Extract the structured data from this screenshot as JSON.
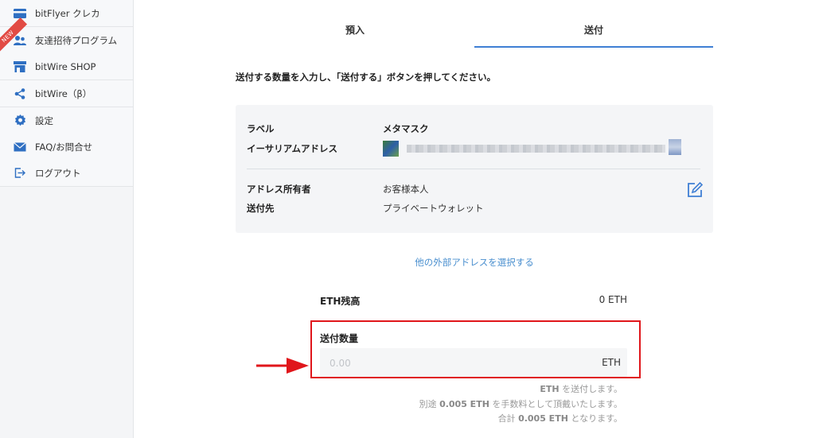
{
  "sidebar": {
    "items": [
      {
        "label": "bitFlyer クレカ",
        "icon": "credit-card-icon"
      },
      {
        "label": "友達招待プログラム",
        "icon": "users-icon",
        "badge": "NEW"
      },
      {
        "label": "bitWire SHOP",
        "icon": "store-icon"
      },
      {
        "label": "bitWire（β）",
        "icon": "share-icon"
      },
      {
        "label": "設定",
        "icon": "gear-icon"
      },
      {
        "label": "FAQ/お問合せ",
        "icon": "mail-icon"
      },
      {
        "label": "ログアウト",
        "icon": "logout-icon"
      }
    ]
  },
  "tabs": [
    {
      "label": "預入",
      "active": false
    },
    {
      "label": "送付",
      "active": true
    }
  ],
  "instruction": "送付する数量を入力し、「送付する」ボタンを押してください。",
  "card": {
    "label_key": "ラベル",
    "label_value": "メタマスク",
    "address_key": "イーサリアムアドレス",
    "owner_key": "アドレス所有者",
    "owner_value": "お客様本人",
    "dest_key": "送付先",
    "dest_value": "プライベートウォレット"
  },
  "other_address_link": "他の外部アドレスを選択する",
  "balance": {
    "label": "ETH残高",
    "value": "0 ETH"
  },
  "amount": {
    "label": "送付数量",
    "placeholder": "0.00",
    "unit": "ETH"
  },
  "notes": {
    "line1_value": "ETH",
    "line1_text": " を送付します。",
    "line2_prefix": "別途 ",
    "line2_value": "0.005 ETH",
    "line2_suffix": " を手数料として頂戴いたします。",
    "line3_prefix": "合計 ",
    "line3_value": "0.005 ETH",
    "line3_suffix": " となります。"
  },
  "colors": {
    "accent": "#3f7fd4",
    "link": "#4a8fcf",
    "highlight": "#e0161b",
    "icon": "#2f6fc2"
  }
}
